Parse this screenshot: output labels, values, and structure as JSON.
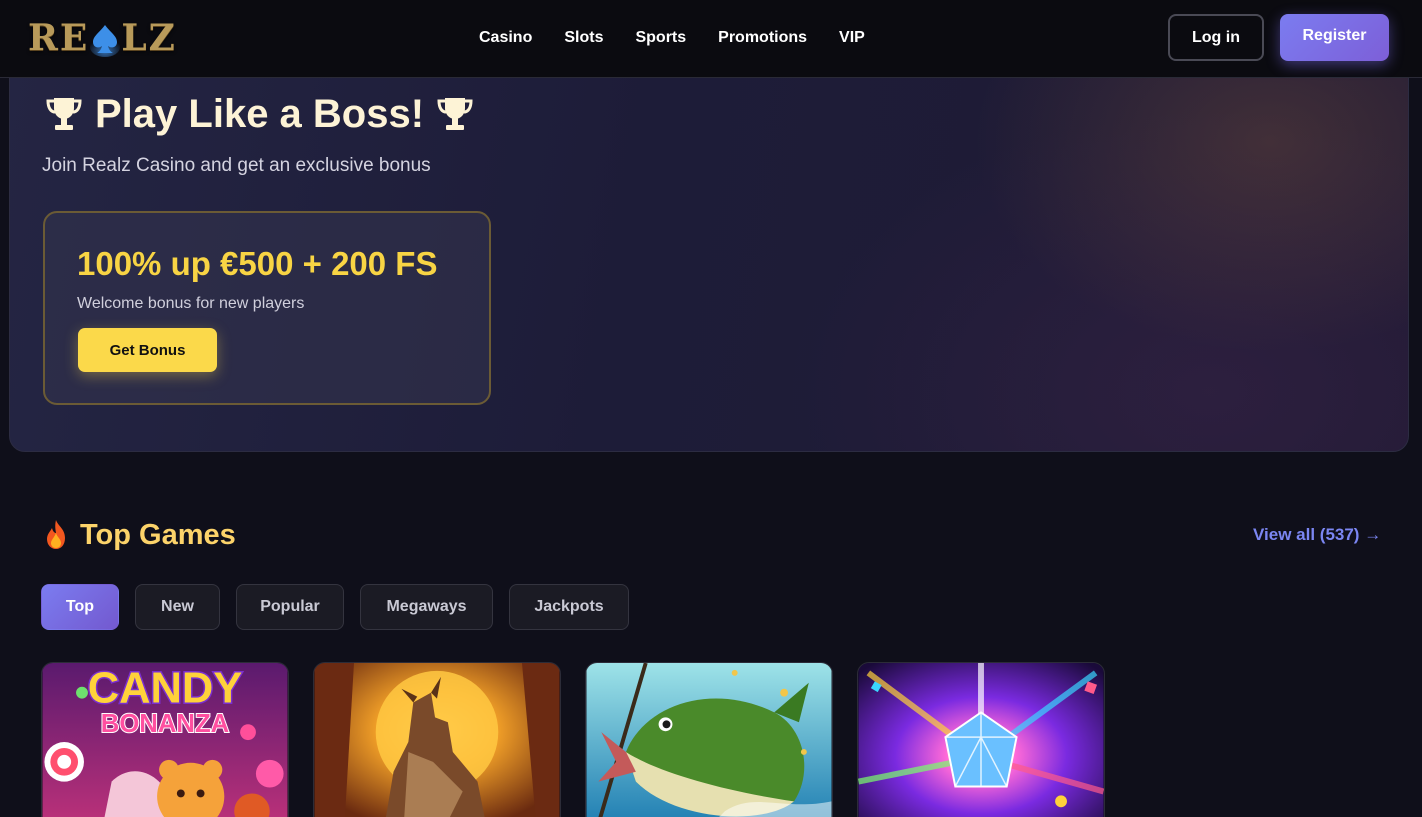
{
  "brand": {
    "logo_left": "RE",
    "logo_right": "LZ",
    "logo_icon": "spade-icon",
    "logo_color": "#b89a5a"
  },
  "nav": {
    "items": [
      {
        "label": "Casino"
      },
      {
        "label": "Slots"
      },
      {
        "label": "Sports"
      },
      {
        "label": "Promotions"
      },
      {
        "label": "VIP"
      }
    ]
  },
  "auth": {
    "login_label": "Log in",
    "register_label": "Register"
  },
  "hero": {
    "title": "Play Like a Boss!",
    "subtitle": "Join Realz Casino and get an exclusive bonus",
    "icon": "trophy-icon",
    "bonus": {
      "amount": "100% up €500 + 200 FS",
      "description": "Welcome bonus for new players",
      "cta_label": "Get Bonus"
    }
  },
  "top_games": {
    "title": "Top Games",
    "icon": "fire-icon",
    "view_all_label": "View all (537) →",
    "tabs": [
      {
        "label": "Top",
        "active": true
      },
      {
        "label": "New",
        "active": false
      },
      {
        "label": "Popular",
        "active": false
      },
      {
        "label": "Megaways",
        "active": false
      },
      {
        "label": "Jackpots",
        "active": false
      }
    ],
    "games": [
      {
        "name": "candy-bonanza",
        "title_line1": "CANDY",
        "title_line2": "BONANZA"
      },
      {
        "name": "wolf-moon"
      },
      {
        "name": "big-bass-fishing"
      },
      {
        "name": "crystal-gem"
      }
    ]
  },
  "colors": {
    "accent": "#7b7cf0",
    "gold": "#f8d444",
    "title_gold": "#fcd36a",
    "background": "#0f0f1a"
  }
}
